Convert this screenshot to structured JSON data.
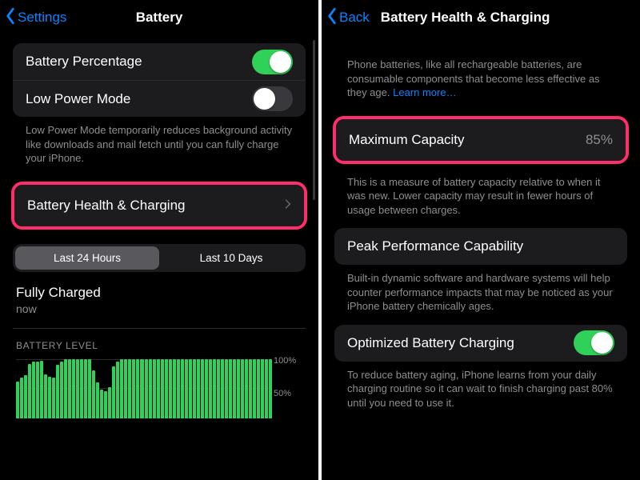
{
  "left": {
    "back_label": "Settings",
    "title": "Battery",
    "rows": {
      "battery_percentage": {
        "label": "Battery Percentage",
        "on": true
      },
      "low_power_mode": {
        "label": "Low Power Mode",
        "on": false
      },
      "low_power_note": "Low Power Mode temporarily reduces background activity like downloads and mail fetch until you can fully charge your iPhone.",
      "health": {
        "label": "Battery Health & Charging"
      }
    },
    "segmented": {
      "a": "Last 24 Hours",
      "b": "Last 10 Days",
      "selected": "a"
    },
    "fully_charged": {
      "title": "Fully Charged",
      "detail": "now"
    },
    "battery_level_label": "BATTERY LEVEL",
    "yticks": {
      "top": "100%",
      "mid": "50%"
    }
  },
  "right": {
    "back_label": "Back",
    "title": "Battery Health & Charging",
    "intro": "Phone batteries, like all rechargeable batteries, are consumable components that become less effective as they age. ",
    "learn_more": "Learn more…",
    "max_capacity": {
      "label": "Maximum Capacity",
      "value": "85%"
    },
    "max_note": "This is a measure of battery capacity relative to when it was new. Lower capacity may result in fewer hours of usage between charges.",
    "peak": {
      "label": "Peak Performance Capability"
    },
    "peak_note": "Built-in dynamic software and hardware systems will help counter performance impacts that may be noticed as your iPhone battery chemically ages.",
    "optimized": {
      "label": "Optimized Battery Charging",
      "on": true
    },
    "optimized_note": "To reduce battery aging, iPhone learns from your daily charging routine so it can wait to finish charging past 80% until you need to use it."
  },
  "chart_data": {
    "type": "bar",
    "title": "BATTERY LEVEL",
    "ylabel": "%",
    "ylim": [
      0,
      100
    ],
    "yticks": [
      50,
      100
    ],
    "categories_note": "hourly over last 24h",
    "values": [
      62,
      68,
      72,
      92,
      95,
      96,
      97,
      74,
      70,
      68,
      90,
      95,
      100,
      100,
      100,
      100,
      100,
      100,
      100,
      80,
      60,
      48,
      45,
      52,
      88,
      96,
      100,
      100,
      100,
      100,
      100,
      100,
      100,
      100,
      100,
      100,
      100,
      100,
      100,
      100,
      100,
      100,
      100,
      100,
      100,
      100,
      100,
      100,
      100,
      100,
      100,
      100,
      100,
      100,
      100,
      100,
      100,
      100,
      100,
      100,
      100,
      100,
      100,
      100
    ]
  }
}
